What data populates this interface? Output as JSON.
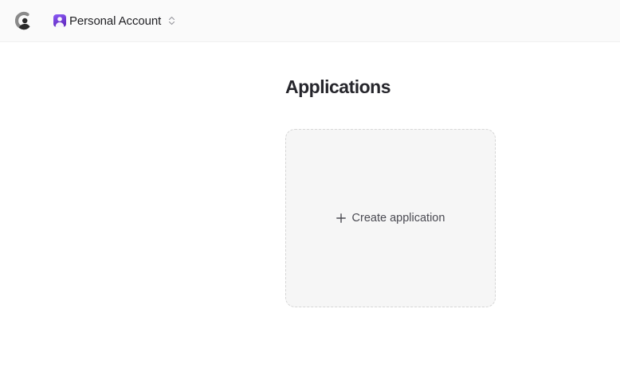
{
  "header": {
    "account_label": "Personal Account"
  },
  "main": {
    "title": "Applications",
    "create_label": "Create application"
  },
  "colors": {
    "avatar_accent": "#7c3aed",
    "topbar_bg": "#fafafa",
    "card_bg": "#f6f6f6"
  },
  "icons": [
    "app-logo-icon",
    "user-avatar-icon",
    "chevron-updown-icon",
    "plus-icon"
  ]
}
